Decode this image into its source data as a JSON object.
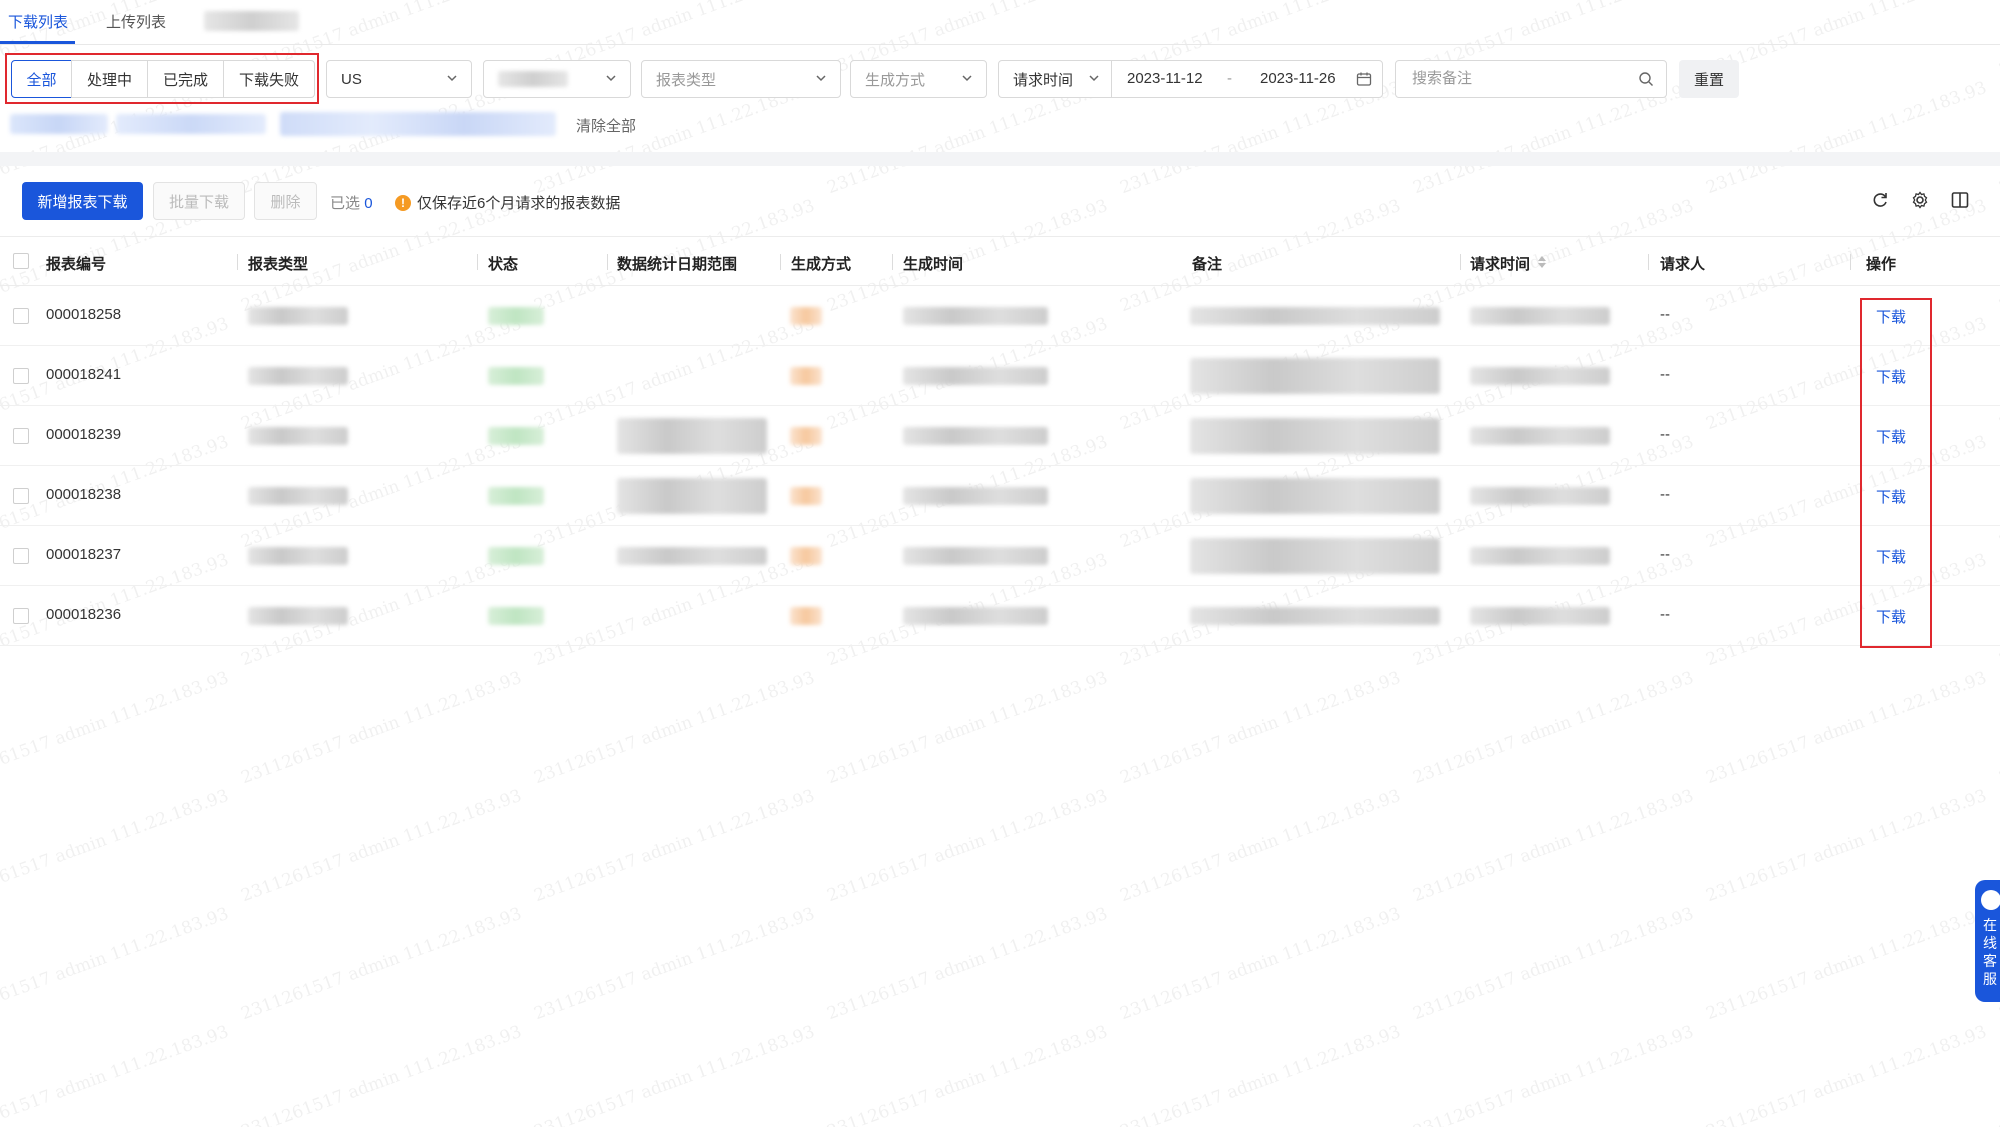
{
  "tabs": [
    {
      "label": "下载列表",
      "active": true
    },
    {
      "label": "上传列表",
      "active": false
    }
  ],
  "filters": {
    "status_segments": [
      "全部",
      "处理中",
      "已完成",
      "下载失败"
    ],
    "site_value": "US",
    "report_type_placeholder": "报表类型",
    "generate_method_placeholder": "生成方式",
    "date_label": "请求时间",
    "date_start": "2023-11-12",
    "date_separator": "-",
    "date_end": "2023-11-26",
    "search_placeholder": "搜索备注",
    "reset_label": "重置",
    "clear_all_label": "清除全部"
  },
  "toolbar": {
    "new_download_label": "新增报表下载",
    "batch_download_label": "批量下载",
    "delete_label": "删除",
    "selected_prefix": "已选",
    "selected_count": "0",
    "notice_icon": "!",
    "notice_text": "仅保存近6个月请求的报表数据"
  },
  "table": {
    "headers": [
      "报表编号",
      "报表类型",
      "状态",
      "数据统计日期范围",
      "生成方式",
      "生成时间",
      "备注",
      "请求时间",
      "请求人",
      "操作"
    ],
    "rows": [
      {
        "id": "000018258",
        "requester": "--",
        "action": "下载"
      },
      {
        "id": "000018241",
        "requester": "--",
        "action": "下载"
      },
      {
        "id": "000018239",
        "requester": "--",
        "action": "下载"
      },
      {
        "id": "000018238",
        "requester": "--",
        "action": "下载"
      },
      {
        "id": "000018237",
        "requester": "--",
        "action": "下载"
      },
      {
        "id": "000018236",
        "requester": "--",
        "action": "下载"
      }
    ]
  },
  "widget": {
    "label_1": "在",
    "label_2": "线",
    "label_3": "客",
    "label_4": "服"
  },
  "colors": {
    "accent": "#1a56db",
    "highlight_border": "#e0282e",
    "warning": "#f59a23"
  }
}
